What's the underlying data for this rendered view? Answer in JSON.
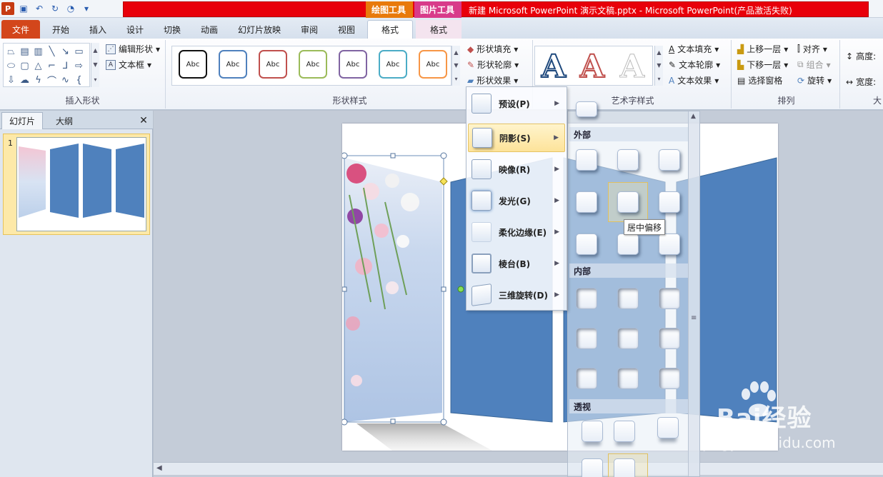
{
  "titlebar": {
    "context_drawing": "绘图工具",
    "context_picture": "图片工具",
    "window_title": "新建 Microsoft PowerPoint 演示文稿.pptx - Microsoft PowerPoint(产品激活失败)",
    "ppt_logo": "P"
  },
  "tabs": [
    {
      "label": "文件"
    },
    {
      "label": "开始"
    },
    {
      "label": "插入"
    },
    {
      "label": "设计"
    },
    {
      "label": "切换"
    },
    {
      "label": "动画"
    },
    {
      "label": "幻灯片放映"
    },
    {
      "label": "审阅"
    },
    {
      "label": "视图"
    },
    {
      "label": "格式"
    },
    {
      "label": "格式"
    }
  ],
  "ribbon": {
    "insert_shapes": {
      "label": "插入形状",
      "edit_shape": "编辑形状",
      "text_box": "文本框"
    },
    "shape_styles": {
      "label": "形状样式",
      "sample": "Abc",
      "fill": "形状填充",
      "outline": "形状轮廓",
      "effects": "形状效果"
    },
    "wordart": {
      "label": "艺术字样式",
      "glyph": "A",
      "text_fill": "文本填充",
      "text_outline": "文本轮廓",
      "text_effects": "文本效果"
    },
    "arrange": {
      "label": "排列",
      "bring_forward": "上移一层",
      "send_backward": "下移一层",
      "selection_pane": "选择窗格",
      "align": "对齐",
      "group": "组合",
      "rotate": "旋转"
    },
    "size": {
      "height": "高度:",
      "width": "宽度:",
      "label_partial": "大"
    }
  },
  "left_panel": {
    "tab_slides": "幻灯片",
    "tab_outline": "大纲",
    "close": "✕",
    "slide_number": "1"
  },
  "shadow_menu": {
    "items": [
      {
        "label": "预设(P)"
      },
      {
        "label": "阴影(S)"
      },
      {
        "label": "映像(R)"
      },
      {
        "label": "发光(G)"
      },
      {
        "label": "柔化边缘(E)"
      },
      {
        "label": "棱台(B)"
      },
      {
        "label": "三维旋转(D)"
      }
    ]
  },
  "gallery": {
    "outer": "外部",
    "inner": "内部",
    "perspective": "透视",
    "tooltip": "居中偏移"
  },
  "watermark": {
    "brand": "Bai经验",
    "url": "jingyan.baidu.com"
  },
  "colors": {
    "title_red": "#e8000a",
    "drawing_tools": "#e87a0c",
    "picture_tools": "#d83b8a",
    "file_tab": "#d3461b",
    "panel_blue": "#4f81bd",
    "selection_gold": "#fde39a"
  }
}
